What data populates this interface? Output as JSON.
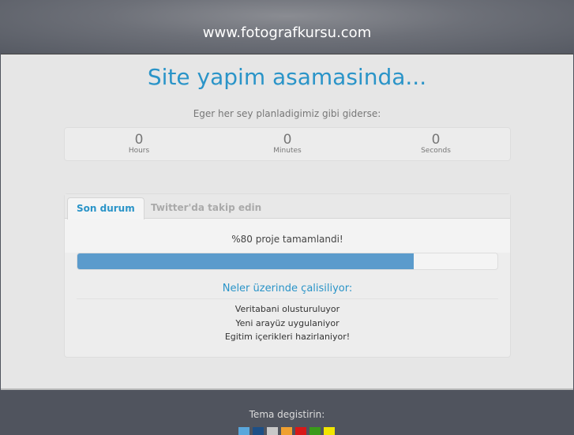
{
  "header": {
    "site": "www.fotografkursu.com"
  },
  "main": {
    "title": "Site yapim asamasinda...",
    "subtitle": "Eger her sey planladigimiz gibi giderse:"
  },
  "countdown": [
    {
      "value": "0",
      "label": "Hours"
    },
    {
      "value": "0",
      "label": "Minutes"
    },
    {
      "value": "0",
      "label": "Seconds"
    }
  ],
  "tabs": [
    {
      "label": "Son durum"
    },
    {
      "label": "Twitter'da takip edin"
    }
  ],
  "status": {
    "progress_text": "%80 proje tamamlandi!",
    "progress": 0.8,
    "heading": "Neler üzerinde çalisiliyor:",
    "items": [
      "Veritabani olusturuluyor",
      "Yeni arayüz uygulaniyor",
      "Egitim içerikleri hazirlaniyor!"
    ]
  },
  "footer": {
    "label": "Tema degistirin:",
    "themes": [
      "#5aa7dc",
      "#1d4f86",
      "#c8c8c8",
      "#f0a030",
      "#d81818",
      "#3a9a1a",
      "#f2e600"
    ]
  }
}
